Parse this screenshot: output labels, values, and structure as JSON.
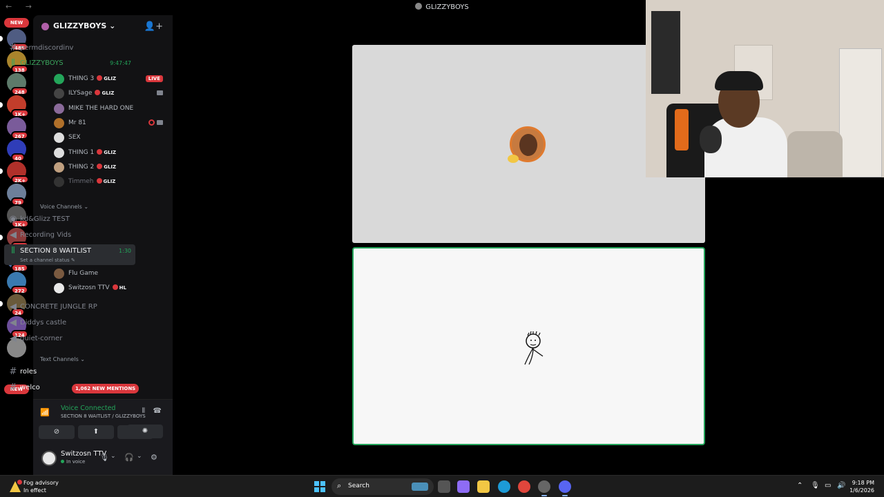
{
  "window": {
    "title": "GLIZZYBOYS",
    "nav": "← →"
  },
  "rail": {
    "badges": [
      "485",
      "138",
      "248",
      "1K+",
      "267",
      "40",
      "2K+",
      "79",
      "1K+",
      "2K+",
      "185",
      "272",
      "24",
      "124"
    ],
    "new_label": "NEW",
    "colors": [
      "#4f5c82",
      "#a9842c",
      "#5d7a6a",
      "#c23d2b",
      "#7a5b9a",
      "#2f3db8",
      "#b0302a",
      "#6d7f9a",
      "#555",
      "#8c3b3b",
      "#4b6aa6",
      "#3a7ab0",
      "#6a5a3a",
      "#6c4e9a",
      "#888"
    ]
  },
  "sidebar": {
    "guild_name": "GLIZZYBOYS",
    "guild_chevron": "⌄",
    "invite_icon": "add-member-icon",
    "channels_top": [
      {
        "icon": "#",
        "label": "permdiscordinv"
      },
      {
        "icon": "voice",
        "label": "GLIZZYBOYS",
        "time": "9:47:47"
      }
    ],
    "voice_users_1": [
      {
        "name": "THING 3",
        "tag": "GLIZ",
        "live": "LIVE",
        "color": "#23a55a"
      },
      {
        "name": "ILYSage",
        "tag": "GLIZ",
        "cam": true,
        "color": "#444"
      },
      {
        "name": "MIKE THE HARD ONE",
        "tag": "",
        "color": "#8a6a9a"
      },
      {
        "name": "Mr 81",
        "tag": "",
        "cam": true,
        "deaf": true,
        "color": "#b0702a"
      },
      {
        "name": "SEX",
        "tag": "",
        "color": "#ddd"
      },
      {
        "name": "THING 1",
        "tag": "GLIZ",
        "color": "#ddd"
      },
      {
        "name": "THING 2",
        "tag": "GLIZ",
        "color": "#c0a080"
      },
      {
        "name": "Timmeh",
        "tag": "GLIZ",
        "dim": true,
        "color": "#333"
      }
    ],
    "category_voice": "Voice Channels ⌄",
    "voice_channels": [
      {
        "icon": "stage",
        "label": "kd&Glizz TEST"
      },
      {
        "icon": "speaker",
        "label": "Recording Vids"
      }
    ],
    "active_channel": {
      "label": "SECTION 8 WAITLIST",
      "time": "1:30",
      "status": "Set a channel status ✎"
    },
    "voice_users_2": [
      {
        "name": "Flu Game",
        "tag": "",
        "color": "#7a5a40"
      },
      {
        "name": "Switzosn TTV",
        "tag": "HL",
        "color": "#e8e8e8"
      }
    ],
    "voice_channels_2": [
      {
        "label": "CONCRETE JUNGLE RP"
      },
      {
        "label": "Diddys castle"
      },
      {
        "label": "quiet-corner"
      }
    ],
    "category_text": "Text Channels ⌄",
    "text_channels": [
      {
        "label": "roles"
      },
      {
        "label": "welco"
      }
    ],
    "mentions": "1,062 NEW MENTIONS"
  },
  "voice_panel": {
    "title": "Voice Connected",
    "subtitle": "SECTION 8 WAITLIST / GLIZZYBOYS",
    "buttons": [
      "camera-off-icon",
      "screen-share-icon",
      "activities-icon",
      "soundboard-icon"
    ],
    "button_glyphs": [
      "⊘",
      "⬆",
      "✦",
      "✺"
    ]
  },
  "user_panel": {
    "name": "Switzosn TTV",
    "status": "In voice",
    "glyphs": {
      "mic": "🎙",
      "chev": "⌄",
      "headset": "🎧",
      "settings": "⚙"
    }
  },
  "taskbar": {
    "weather_line1": "Fog advisory",
    "weather_line2": "In effect",
    "search": "Search",
    "search_glyph": "⌕",
    "tray_glyphs": [
      "⌃",
      "🎙",
      "▭",
      "🔊"
    ],
    "time": "9:18 PM",
    "date": "1/6/2026",
    "apps": [
      {
        "name": "task-view-icon",
        "color": "#555"
      },
      {
        "name": "copilot-icon",
        "color": "#8e6cf5"
      },
      {
        "name": "file-explorer-icon",
        "color": "#f2c744"
      },
      {
        "name": "edge-icon",
        "color": "#1d9bd7"
      },
      {
        "name": "chrome-icon",
        "color": "#e0463c"
      },
      {
        "name": "settings-app-icon",
        "color": "#666"
      },
      {
        "name": "discord-app-icon",
        "color": "#5865f2"
      }
    ]
  }
}
